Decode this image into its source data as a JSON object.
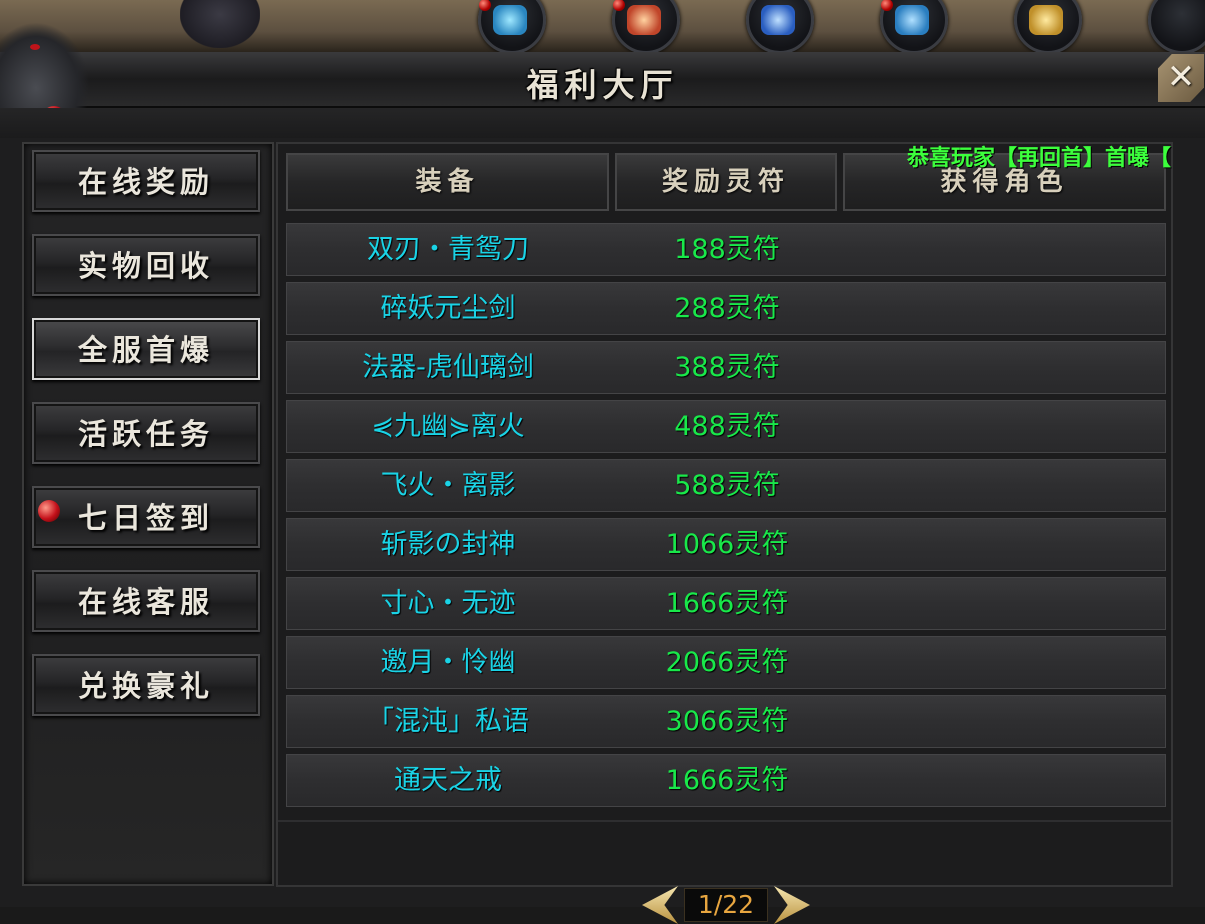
{
  "window": {
    "title": "福利大厅",
    "close_label": "✕"
  },
  "ticker": {
    "prefix": "恭喜玩家",
    "player": "【再回首】",
    "suffix": "首曝【",
    "color_text": "#3cff3c",
    "color_player": "#ff3cff"
  },
  "sidebar": {
    "items": [
      {
        "label": "在线奖励",
        "active": false,
        "badge": false
      },
      {
        "label": "实物回收",
        "active": false,
        "badge": false
      },
      {
        "label": "全服首爆",
        "active": true,
        "badge": false
      },
      {
        "label": "活跃任务",
        "active": false,
        "badge": false
      },
      {
        "label": "七日签到",
        "active": false,
        "badge": true
      },
      {
        "label": "在线客服",
        "active": false,
        "badge": false
      },
      {
        "label": "兑换豪礼",
        "active": false,
        "badge": false
      }
    ]
  },
  "table": {
    "headers": [
      "装备",
      "奖励灵符",
      "获得角色"
    ],
    "rows": [
      {
        "equip": "双刃・青鸳刀",
        "reward": "188灵符",
        "role": ""
      },
      {
        "equip": "碎妖元尘剑",
        "reward": "288灵符",
        "role": ""
      },
      {
        "equip": "法器-虎仙璃剑",
        "reward": "388灵符",
        "role": ""
      },
      {
        "equip": "⋞九幽⋟离火",
        "reward": "488灵符",
        "role": ""
      },
      {
        "equip": "飞火・离影",
        "reward": "588灵符",
        "role": ""
      },
      {
        "equip": "斩影の封神",
        "reward": "1066灵符",
        "role": ""
      },
      {
        "equip": "寸心・无迹",
        "reward": "1666灵符",
        "role": ""
      },
      {
        "equip": "邀月・怜幽",
        "reward": "2066灵符",
        "role": ""
      },
      {
        "equip": "「混沌」私语",
        "reward": "3066灵符",
        "role": ""
      },
      {
        "equip": "通天之戒",
        "reward": "1666灵符",
        "role": ""
      }
    ]
  },
  "pager": {
    "page_text": "1/22"
  },
  "top_orbs": [
    {
      "name": "potion-icon",
      "color": "#3aa6d8"
    },
    {
      "name": "gift-bag-icon",
      "color": "#d8553a"
    },
    {
      "name": "costume-icon",
      "color": "#3a7ed8"
    },
    {
      "name": "treasure-box-icon",
      "color": "#3a9ed8"
    },
    {
      "name": "gold-ingot-icon",
      "color": "#d8a83a"
    }
  ]
}
